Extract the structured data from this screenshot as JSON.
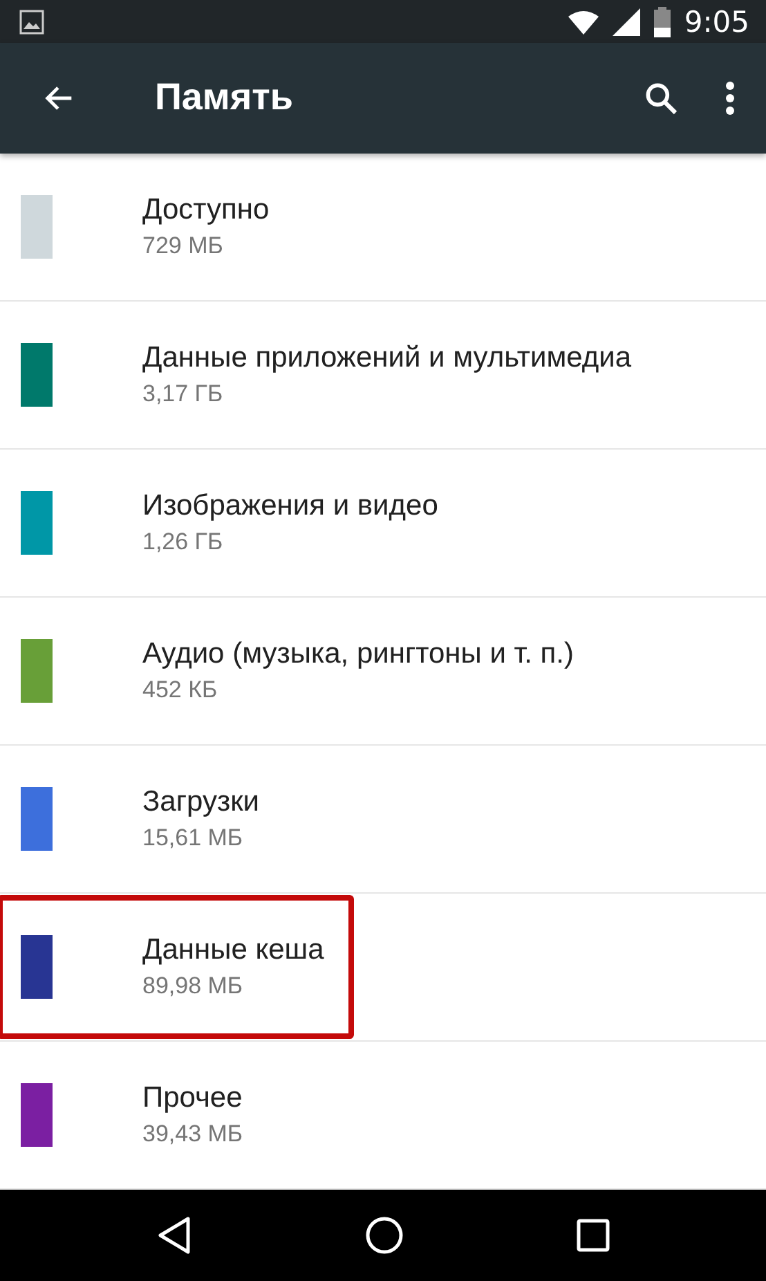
{
  "status_bar": {
    "time": "9:05"
  },
  "toolbar": {
    "title": "Память"
  },
  "items": [
    {
      "title": "Доступно",
      "size": "729 МБ",
      "color": "#cfd8dc",
      "highlighted": false
    },
    {
      "title": "Данные приложений и мультимедиа",
      "size": "3,17 ГБ",
      "color": "#00796b",
      "highlighted": false
    },
    {
      "title": "Изображения и видео",
      "size": "1,26 ГБ",
      "color": "#0097a7",
      "highlighted": false
    },
    {
      "title": "Аудио (музыка, рингтоны и т. п.)",
      "size": "452 КБ",
      "color": "#689f38",
      "highlighted": false
    },
    {
      "title": "Загрузки",
      "size": "15,61 МБ",
      "color": "#3d6fdc",
      "highlighted": false
    },
    {
      "title": "Данные кеша",
      "size": "89,98 МБ",
      "color": "#283593",
      "highlighted": true
    },
    {
      "title": "Прочее",
      "size": "39,43 МБ",
      "color": "#7b1fa2",
      "highlighted": false
    }
  ]
}
